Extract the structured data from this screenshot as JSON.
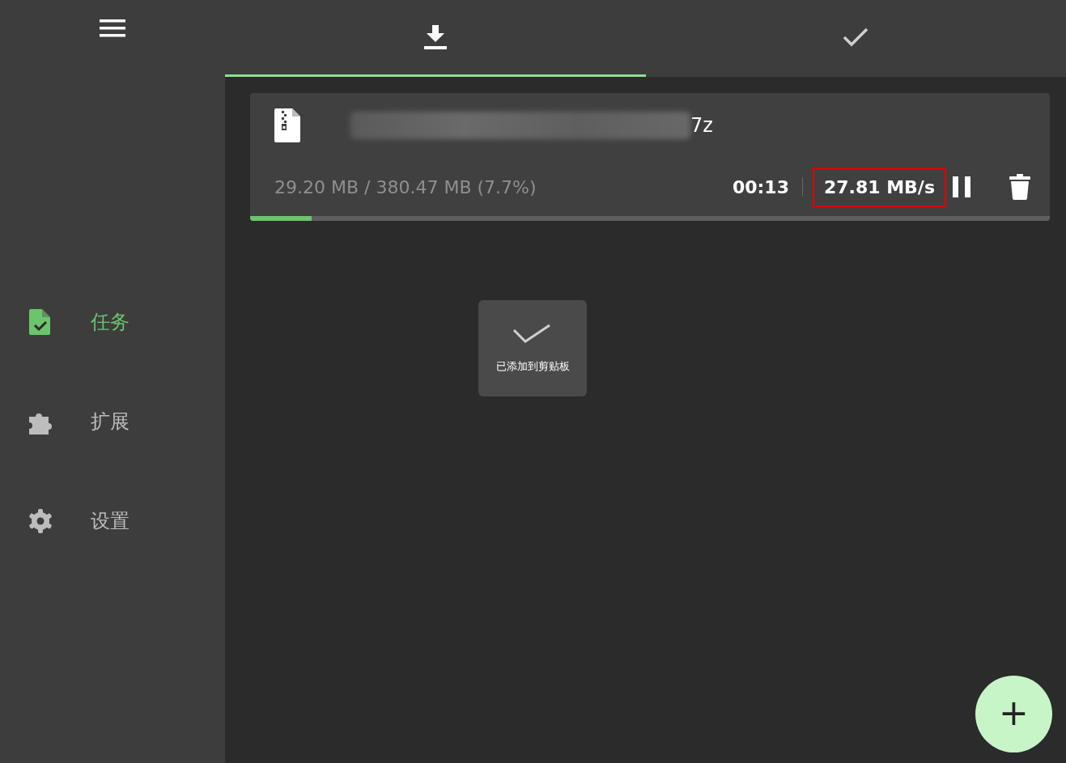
{
  "sidebar": {
    "items": [
      {
        "label": "任务",
        "kind": "tasks",
        "selected": true
      },
      {
        "label": "扩展",
        "kind": "extensions",
        "selected": false
      },
      {
        "label": "设置",
        "kind": "settings",
        "selected": false
      }
    ]
  },
  "tabs": [
    {
      "kind": "downloading",
      "selected": true
    },
    {
      "kind": "completed",
      "selected": false
    }
  ],
  "tasks": [
    {
      "file_name_visible": "7z",
      "progress_text": "29.20 MB / 380.47 MB (7.7%)",
      "time_left": "00:13",
      "speed": "27.81 MB/s",
      "speed_highlighted": true,
      "paused": false,
      "level": 0.077
    }
  ],
  "toast": {
    "text": "已添加到剪贴板"
  },
  "fab": {
    "label": "+"
  }
}
